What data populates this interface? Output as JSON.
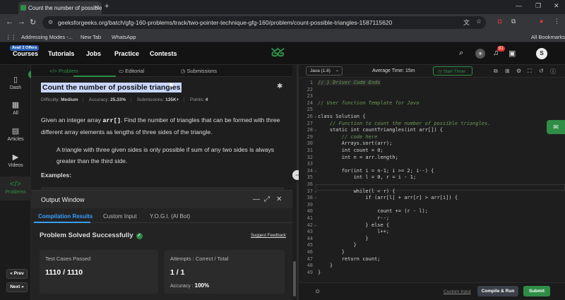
{
  "browser": {
    "tab_title": "Count the number of possible t",
    "url": "geeksforgeeks.org/batch/gfg-160-problems/track/two-pointer-technique-gfg-160/problem/count-possible-triangles-1587115620",
    "bookmarks": [
      "Addressing Modes -...",
      "New Tab",
      "WhatsApp"
    ],
    "all_bookmarks": "All Bookmarks"
  },
  "header": {
    "offer_badge": "Avail 2 Offers",
    "menu": [
      "Courses",
      "Tutorials",
      "Jobs",
      "Practice",
      "Contests"
    ],
    "notification_count": "91",
    "profile_initial": "S"
  },
  "sidebar": {
    "items": [
      "Dash",
      "All",
      "Articles",
      "Videos",
      "Problems"
    ],
    "prev": "Prev",
    "next": "Next"
  },
  "problem_tabs": [
    "Problem",
    "Editorial",
    "Submissions"
  ],
  "problem": {
    "title": "Count the number of possible triangles",
    "difficulty_label": "Difficulty:",
    "difficulty": "Medium",
    "accuracy_label": "Accuracy:",
    "accuracy": "25.33%",
    "submissions_label": "Submissions:",
    "submissions": "135K+",
    "points_label": "Points:",
    "points": "4",
    "desc_1": "Given an integer array ",
    "desc_code": "arr[]",
    "desc_2": ". Find the number of triangles that can be formed with three different array elements as lengths of three sides of the triangle.",
    "note": "A triangle with three given sides is only possible if sum of any two sides is always greater than the third side.",
    "examples": "Examples:"
  },
  "output": {
    "title": "Output Window",
    "tabs": [
      "Compilation Results",
      "Custom Input",
      "Y.O.G.I. (AI Bot)"
    ],
    "status": "Problem Solved Successfully",
    "suggest": "Suggest Feedback",
    "tc_label": "Test Cases Passed",
    "tc_value": "1110 / 1110",
    "att_label": "Attempts : Correct / Total",
    "att_value": "1 / 1",
    "acc_label": "Accuracy :",
    "acc_value": "100%"
  },
  "editor": {
    "language": "Java (1.8)",
    "avg_time": "Average Time: 15m",
    "start_timer": "Start Timer",
    "lines": [
      {
        "n": "1",
        "t": "// } Driver Code Ends"
      },
      {
        "n": "22",
        "t": ""
      },
      {
        "n": "23",
        "t": ""
      },
      {
        "n": "24",
        "t": "// User function Template for Java"
      },
      {
        "n": "25",
        "t": ""
      },
      {
        "n": "26",
        "t": "class Solution {"
      },
      {
        "n": "27",
        "t": "    // Function to count the number of possible triangles."
      },
      {
        "n": "28",
        "t": "    static int countTriangles(int arr[]) {"
      },
      {
        "n": "29",
        "t": "        // code here"
      },
      {
        "n": "30",
        "t": "        Arrays.sort(arr);"
      },
      {
        "n": "31",
        "t": "        int count = 0;"
      },
      {
        "n": "32",
        "t": "        int n = arr.length;"
      },
      {
        "n": "33",
        "t": ""
      },
      {
        "n": "34",
        "t": "        for(int i = n-1; i >= 2; i--) {"
      },
      {
        "n": "35",
        "t": "            int l = 0, r = i - 1;"
      },
      {
        "n": "36",
        "t": ""
      },
      {
        "n": "37",
        "t": "            while(l < r) {"
      },
      {
        "n": "38",
        "t": "                if (arr[l] + arr[r] > arr[i]) {"
      },
      {
        "n": "39",
        "t": ""
      },
      {
        "n": "40",
        "t": "                    count += (r - l);"
      },
      {
        "n": "41",
        "t": "                    r--;"
      },
      {
        "n": "42",
        "t": "                } else {"
      },
      {
        "n": "43",
        "t": "                    l++;"
      },
      {
        "n": "44",
        "t": "                }"
      },
      {
        "n": "45",
        "t": "            }"
      },
      {
        "n": "46",
        "t": "        }"
      },
      {
        "n": "47",
        "t": "        return count;"
      },
      {
        "n": "48",
        "t": "    }"
      },
      {
        "n": "49",
        "t": "}"
      }
    ],
    "custom_input": "Custom Input",
    "compile_run": "Compile & Run",
    "submit": "Submit"
  },
  "colors": {
    "accent": "#2f8d46",
    "link": "#3b9eff"
  }
}
